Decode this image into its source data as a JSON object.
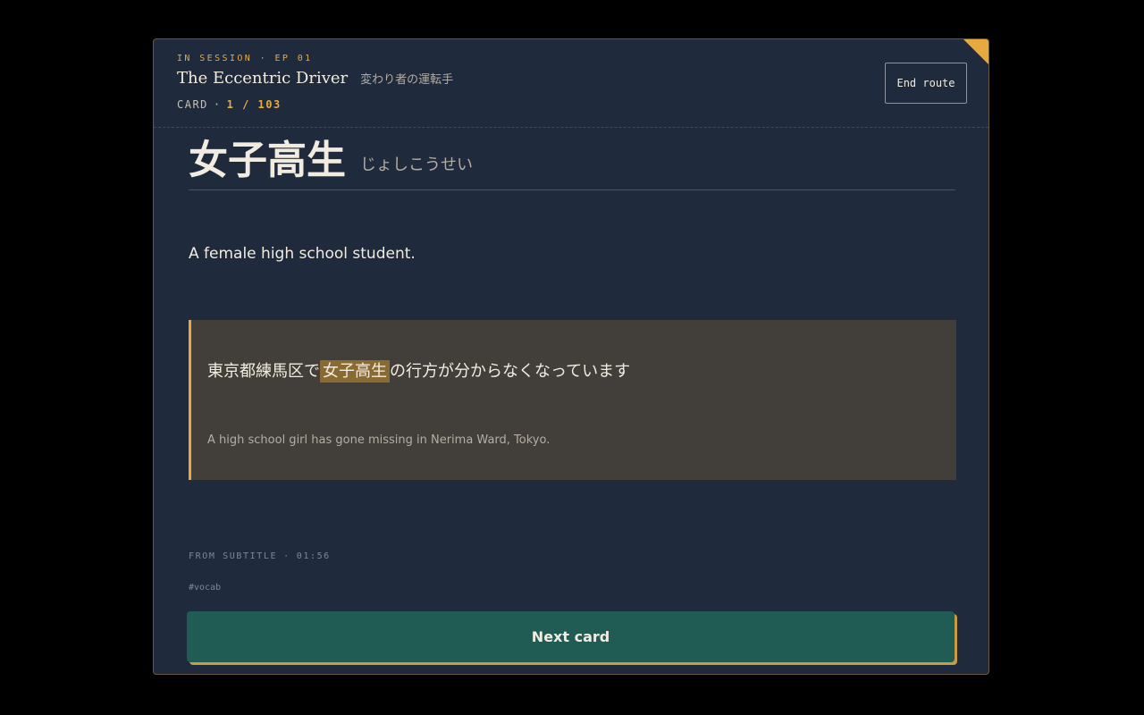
{
  "header": {
    "session_label": "IN SESSION · EP 01",
    "title_en": "The Eccentric Driver",
    "title_ja": "変わり者の運転手",
    "counter_label": "CARD",
    "counter_value": "1 / 103",
    "end_button_label": "End route"
  },
  "card": {
    "term": "女子高生",
    "reading": "じょしこうせい",
    "definition": "A female high school student.",
    "example": {
      "before": "東京都練馬区で",
      "highlight": "女子高生",
      "after": "の行方が分からなくなっています",
      "translation": "A high school girl has gone missing in Nerima Ward, Tokyo."
    },
    "source_label": "FROM SUBTITLE",
    "source_time": "01:56",
    "tag": "#vocab"
  },
  "actions": {
    "next_label": "Next card"
  },
  "colors": {
    "accent": "#e8a93f",
    "background": "#1f2a3c",
    "button": "#205c53",
    "highlight": "#8a6a33"
  }
}
